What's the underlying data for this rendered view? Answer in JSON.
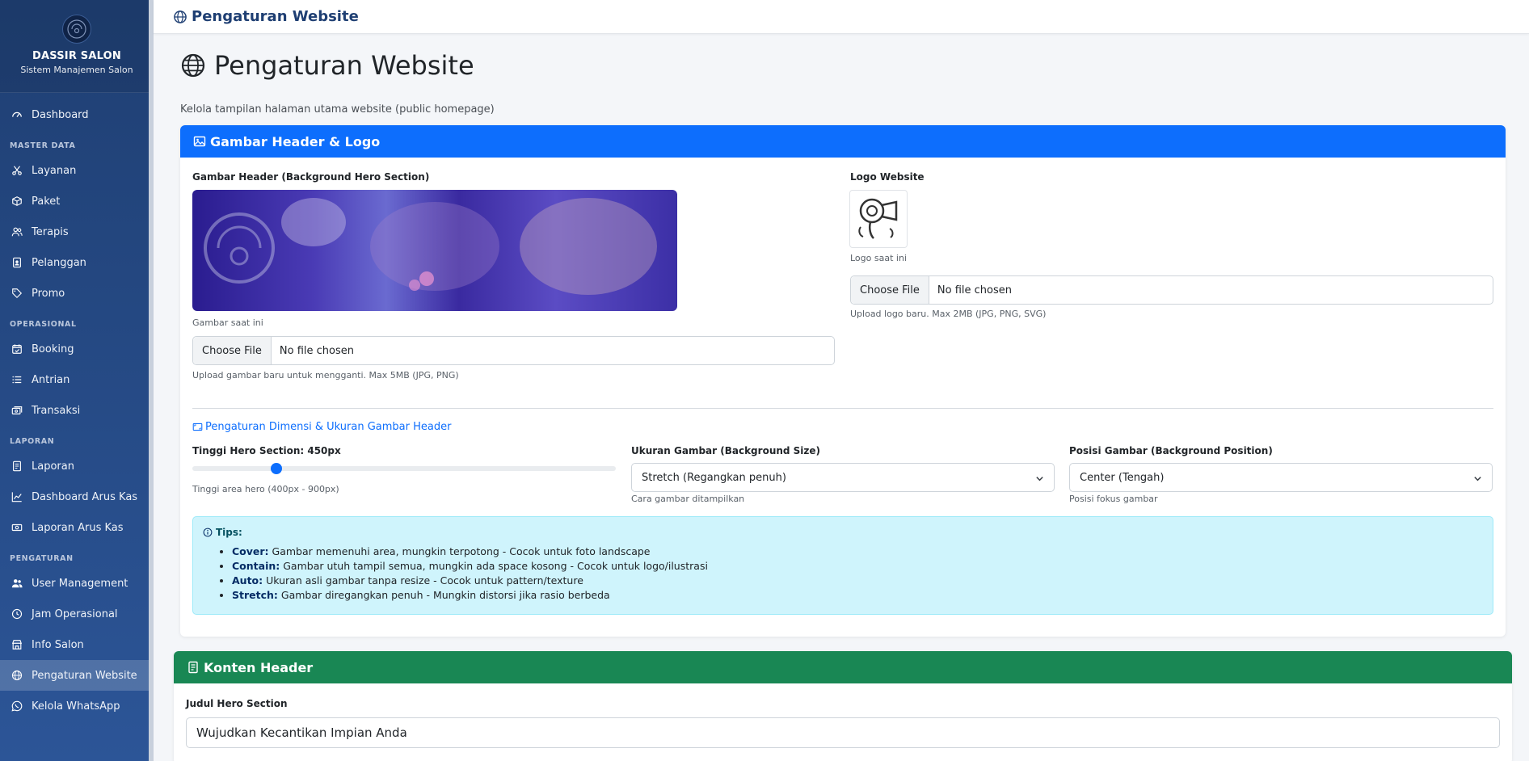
{
  "brand": {
    "name": "DASSIR SALON",
    "subtitle": "Sistem Manajemen Salon"
  },
  "sidebar": {
    "dashboard": "Dashboard",
    "sections": [
      {
        "title": "MASTER DATA",
        "items": [
          "Layanan",
          "Paket",
          "Terapis",
          "Pelanggan",
          "Promo"
        ]
      },
      {
        "title": "OPERASIONAL",
        "items": [
          "Booking",
          "Antrian",
          "Transaksi"
        ]
      },
      {
        "title": "LAPORAN",
        "items": [
          "Laporan",
          "Dashboard Arus Kas",
          "Laporan Arus Kas"
        ]
      },
      {
        "title": "PENGATURAN",
        "items": [
          "User Management",
          "Jam Operasional",
          "Info Salon",
          "Pengaturan Website",
          "Kelola WhatsApp"
        ]
      }
    ]
  },
  "topbar": {
    "title": "Pengaturan Website"
  },
  "page": {
    "title": "Pengaturan Website",
    "subtitle": "Kelola tampilan halaman utama website (public homepage)"
  },
  "header_card": {
    "title": "Gambar Header & Logo",
    "hero_label": "Gambar Header (Background Hero Section)",
    "hero_caption": "Gambar saat ini",
    "hero_file_btn": "Choose File",
    "hero_file_txt": "No file chosen",
    "hero_help": "Upload gambar baru untuk mengganti. Max 5MB (JPG, PNG)",
    "logo_label": "Logo Website",
    "logo_caption": "Logo saat ini",
    "logo_file_btn": "Choose File",
    "logo_file_txt": "No file chosen",
    "logo_help": "Upload logo baru. Max 2MB (JPG, PNG, SVG)",
    "dim_title": "Pengaturan Dimensi & Ukuran Gambar Header",
    "height_label": "Tinggi Hero Section: 450px",
    "height_value": 450,
    "height_min": 400,
    "height_max": 900,
    "height_help": "Tinggi area hero (400px - 900px)",
    "size_label": "Ukuran Gambar (Background Size)",
    "size_value": "Stretch (Regangkan penuh)",
    "size_help": "Cara gambar ditampilkan",
    "pos_label": "Posisi Gambar (Background Position)",
    "pos_value": "Center (Tengah)",
    "pos_help": "Posisi fokus gambar",
    "tips_title": "Tips:",
    "tips": [
      {
        "key": "Cover:",
        "text": " Gambar memenuhi area, mungkin terpotong - Cocok untuk foto landscape"
      },
      {
        "key": "Contain:",
        "text": " Gambar utuh tampil semua, mungkin ada space kosong - Cocok untuk logo/ilustrasi"
      },
      {
        "key": "Auto:",
        "text": " Ukuran asli gambar tanpa resize - Cocok untuk pattern/texture"
      },
      {
        "key": "Stretch:",
        "text": " Gambar diregangkan penuh - Mungkin distorsi jika rasio berbeda"
      }
    ]
  },
  "content_card": {
    "title": "Konten Header",
    "hero_title_label": "Judul Hero Section",
    "hero_title_value": "Wujudkan Kecantikan Impian Anda"
  },
  "colors": {
    "primary": "#0d6efd",
    "success": "#198754",
    "sidebar": "#1f3f73",
    "info_bg": "#cff4fc"
  }
}
